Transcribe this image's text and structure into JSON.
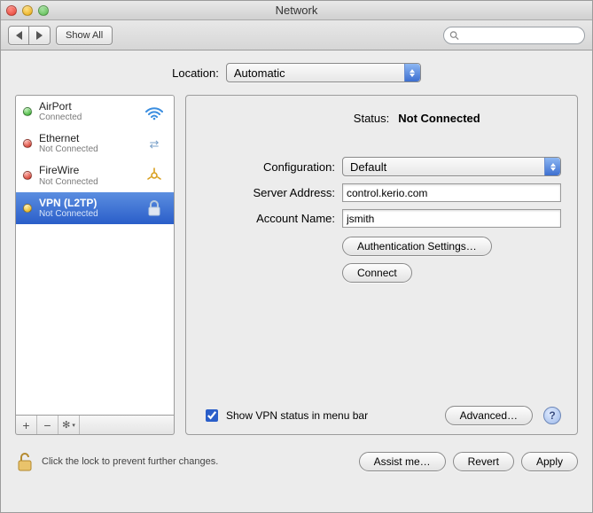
{
  "window": {
    "title": "Network"
  },
  "toolbar": {
    "show_all": "Show All",
    "search_placeholder": ""
  },
  "location": {
    "label": "Location:",
    "value": "Automatic"
  },
  "sidebar": {
    "items": [
      {
        "name": "AirPort",
        "status": "Connected",
        "dot": "green",
        "icon": "wifi-icon"
      },
      {
        "name": "Ethernet",
        "status": "Not Connected",
        "dot": "red",
        "icon": "ethernet-icon"
      },
      {
        "name": "FireWire",
        "status": "Not Connected",
        "dot": "red",
        "icon": "firewire-icon"
      },
      {
        "name": "VPN (L2TP)",
        "status": "Not Connected",
        "dot": "yellow",
        "icon": "lock-icon",
        "selected": true
      }
    ],
    "tools": {
      "plus": "+",
      "minus": "−",
      "gear": "⚙"
    }
  },
  "detail": {
    "status_label": "Status:",
    "status_value": "Not Connected",
    "config_label": "Configuration:",
    "config_value": "Default",
    "server_label": "Server Address:",
    "server_value": "control.kerio.com",
    "account_label": "Account Name:",
    "account_value": "jsmith",
    "auth_btn": "Authentication Settings…",
    "connect_btn": "Connect",
    "show_vpn_label": "Show VPN status in menu bar",
    "show_vpn_checked": true,
    "advanced_btn": "Advanced…"
  },
  "footer": {
    "lock_text": "Click the lock to prevent further changes.",
    "assist": "Assist me…",
    "revert": "Revert",
    "apply": "Apply"
  }
}
